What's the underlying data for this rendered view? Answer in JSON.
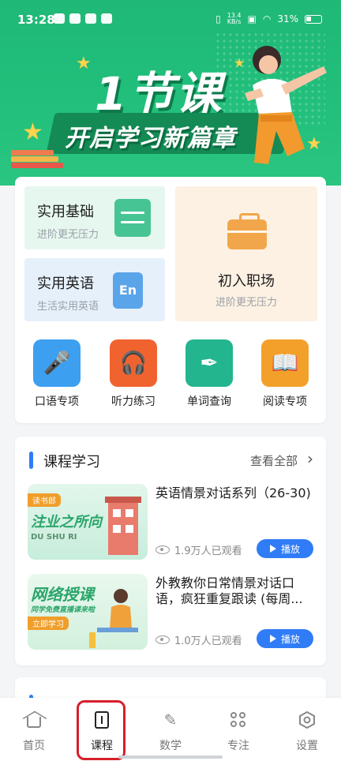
{
  "status_bar": {
    "time": "13:28",
    "speed_top": "13.4",
    "speed_bottom": "KB/s",
    "battery": "31%"
  },
  "banner": {
    "headline": "1节课",
    "subline": "开启学习新篇章"
  },
  "tiles": [
    {
      "title": "实用基础",
      "subtitle": "进阶更无压力"
    },
    {
      "title": "实用英语",
      "subtitle": "生活实用英语"
    },
    {
      "title": "初入职场",
      "subtitle": "进阶更无压力"
    }
  ],
  "tile_art": {
    "english_badge": "En"
  },
  "quick_actions": [
    {
      "label": "口语专项",
      "icon": "microphone-icon"
    },
    {
      "label": "听力练习",
      "icon": "headphones-icon"
    },
    {
      "label": "单词查询",
      "icon": "pen-nib-icon"
    },
    {
      "label": "阅读专项",
      "icon": "book-icon"
    }
  ],
  "course_section": {
    "title": "课程学习",
    "more": "查看全部",
    "courses": [
      {
        "title": "英语情景对话系列（26-30)",
        "views": "1.9万人已观看",
        "play": "播放",
        "thumb_text_1": "读书郎",
        "thumb_text_2": "注业之所向",
        "thumb_text_3": "DU SHU RI"
      },
      {
        "title": "外教教你日常情景对话口语，疯狂重复跟读 (每周...",
        "views": "1.0万人已观看",
        "play": "播放",
        "thumb_text_1": "网络授课",
        "thumb_text_2": "同学免费直播课来啦",
        "thumb_tag": "立即学习"
      }
    ]
  },
  "bottom_nav": [
    {
      "label": "首页",
      "icon": "home-icon"
    },
    {
      "label": "课程",
      "icon": "course-book-icon",
      "active": true
    },
    {
      "label": "数学",
      "icon": "pencil-icon"
    },
    {
      "label": "专注",
      "icon": "grid-icon"
    },
    {
      "label": "设置",
      "icon": "settings-hex-icon"
    }
  ],
  "colors": {
    "banner_green": "#22c07c",
    "accent_blue": "#2f7cf6",
    "highlight_red": "#d61f2b"
  }
}
